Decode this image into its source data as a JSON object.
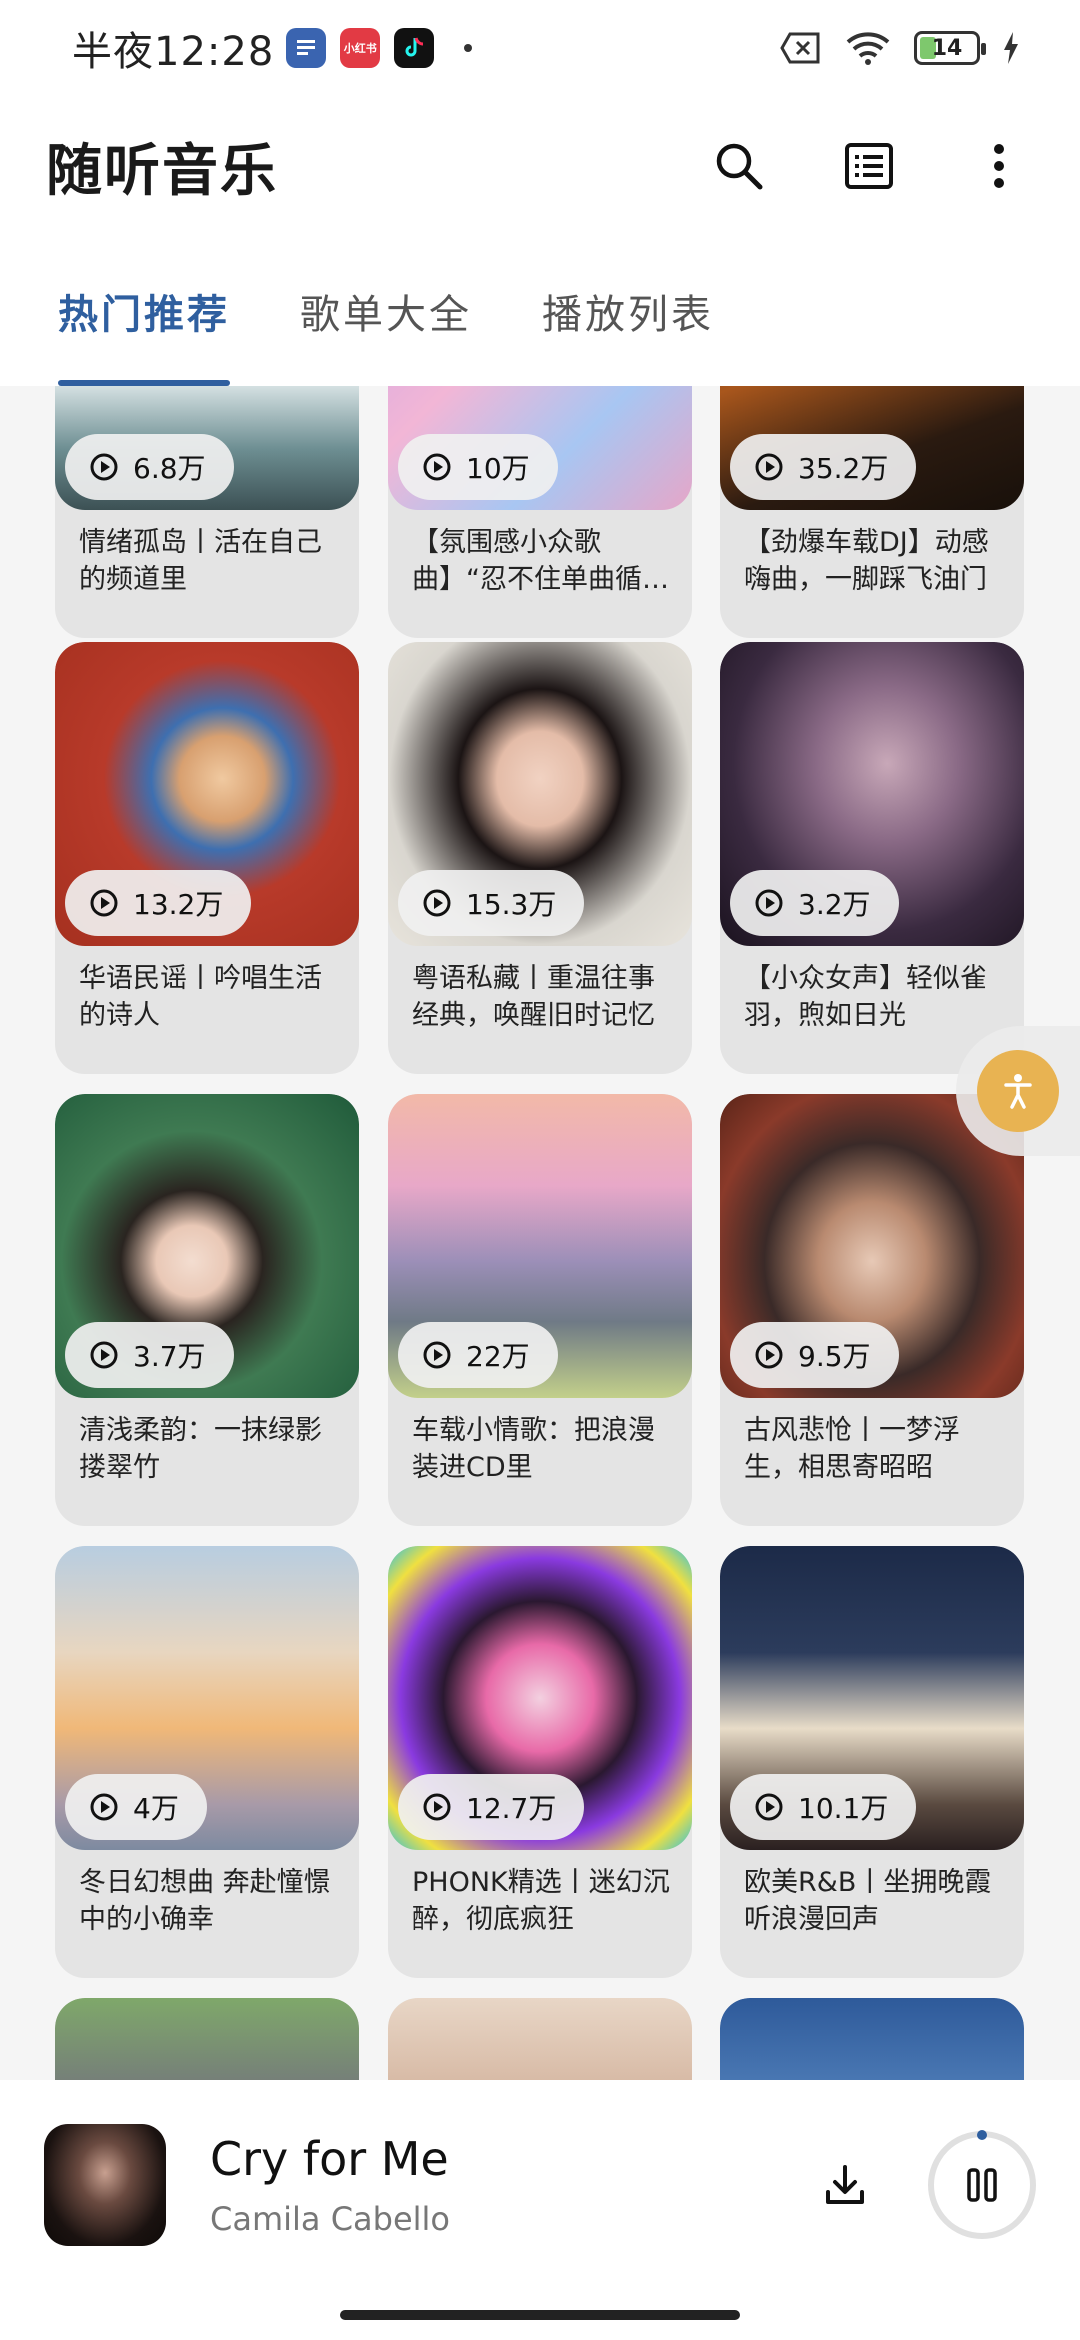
{
  "status_bar": {
    "time": "半夜12:28",
    "apps": [
      {
        "icon": "music-app-icon",
        "color": "#3a64b0",
        "label": "♫"
      },
      {
        "icon": "xiaohongshu-app-icon",
        "color": "#e23a44",
        "label": "小红书"
      },
      {
        "icon": "tiktok-app-icon",
        "color": "#111111",
        "label": "♪"
      }
    ],
    "battery": "14"
  },
  "app": {
    "title": "随听音乐"
  },
  "tabs": [
    {
      "label": "热门推荐",
      "active": true
    },
    {
      "label": "歌单大全",
      "active": false
    },
    {
      "label": "播放列表",
      "active": false
    }
  ],
  "playlists": [
    {
      "count": "6.8万",
      "title": "情绪孤岛丨活在自己的频道里"
    },
    {
      "count": "10万",
      "title": "【氛围感小众歌曲】“忍不住单曲循环！”"
    },
    {
      "count": "35.2万",
      "title": "【劲爆车载DJ】动感嗨曲，一脚踩飞油门"
    },
    {
      "count": "13.2万",
      "title": "华语民谣丨吟唱生活的诗人"
    },
    {
      "count": "15.3万",
      "title": "粤语私藏丨重温往事经典，唤醒旧时记忆"
    },
    {
      "count": "3.2万",
      "title": "【小众女声】轻似雀羽，煦如日光"
    },
    {
      "count": "3.7万",
      "title": "清浅柔韵：一抹绿影搂翠竹"
    },
    {
      "count": "22万",
      "title": "车载小情歌：把浪漫装进CD里"
    },
    {
      "count": "9.5万",
      "title": "古风悲怆丨一梦浮生，相思寄昭昭"
    },
    {
      "count": "4万",
      "title": "冬日幻想曲 奔赴憧憬中的小确幸"
    },
    {
      "count": "12.7万",
      "title": "PHONK精选丨迷幻沉醉，彻底疯狂"
    },
    {
      "count": "10.1万",
      "title": "欧美R&B丨坐拥晚霞听浪漫回声"
    }
  ],
  "now_playing": {
    "title": "Cry for Me",
    "artist": "Camila Cabello"
  },
  "colors": {
    "accent": "#2f5f9f",
    "card_bg": "#e4e4e4",
    "page_bg": "#f5f5f5"
  }
}
